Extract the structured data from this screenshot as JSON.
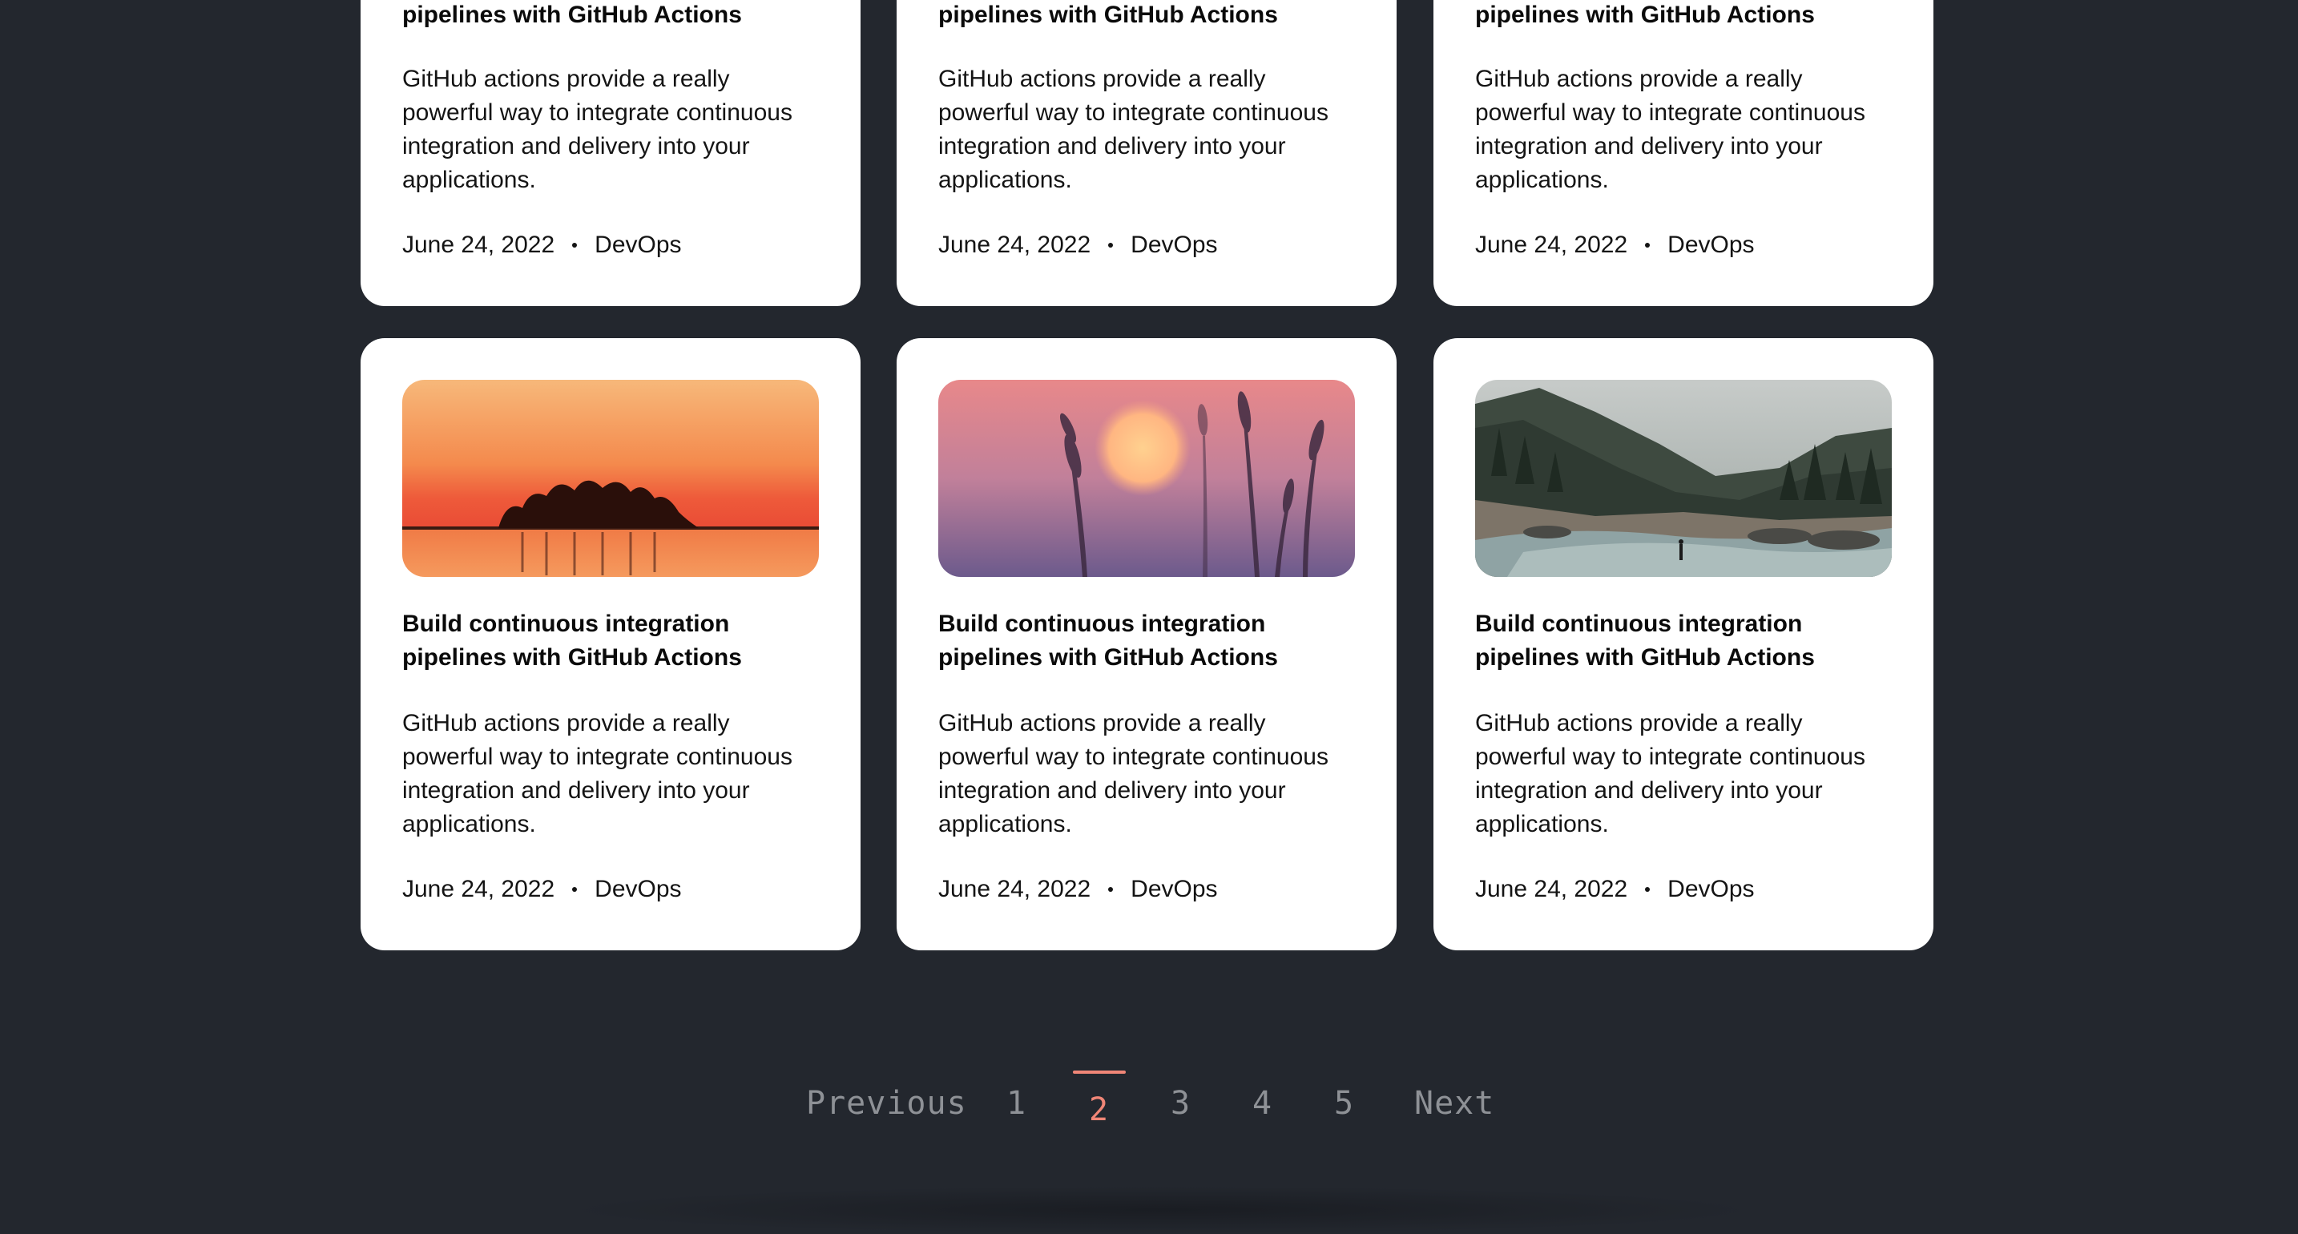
{
  "colors": {
    "background": "#23272e",
    "card": "#ffffff",
    "accent": "#f08677",
    "pagination_text": "#8e9196"
  },
  "cards_top": [
    {
      "title_line2": "pipelines with GitHub Actions",
      "description": "GitHub actions provide a really powerful way to integrate continuous integration and delivery into your applications.",
      "date": "June 24, 2022",
      "category": "DevOps"
    },
    {
      "title_line2": "pipelines with GitHub Actions",
      "description": "GitHub actions provide a really powerful way to integrate continuous integration and delivery into your applications.",
      "date": "June 24, 2022",
      "category": "DevOps"
    },
    {
      "title_line2": "pipelines with GitHub Actions",
      "description": "GitHub actions provide a really powerful way to integrate continuous integration and delivery into your applications.",
      "date": "June 24, 2022",
      "category": "DevOps"
    }
  ],
  "cards_bottom": [
    {
      "image": "sunset-lake-island-image",
      "title": "Build continuous integration pipelines with GitHub Actions",
      "description": "GitHub actions provide a really powerful way to integrate continuous integration and delivery into your applications.",
      "date": "June 24, 2022",
      "category": "DevOps"
    },
    {
      "image": "wheat-sunset-image",
      "title": "Build continuous integration pipelines with GitHub Actions",
      "description": "GitHub actions provide a really powerful way to integrate continuous integration and delivery into your applications.",
      "date": "June 24, 2022",
      "category": "DevOps"
    },
    {
      "image": "forest-river-image",
      "title": "Build continuous integration pipelines with GitHub Actions",
      "description": "GitHub actions provide a really powerful way to integrate continuous integration and delivery into your applications.",
      "date": "June 24, 2022",
      "category": "DevOps"
    }
  ],
  "pagination": {
    "previous": "Previous",
    "pages": [
      "1",
      "2",
      "3",
      "4",
      "5"
    ],
    "current": "2",
    "next": "Next"
  }
}
